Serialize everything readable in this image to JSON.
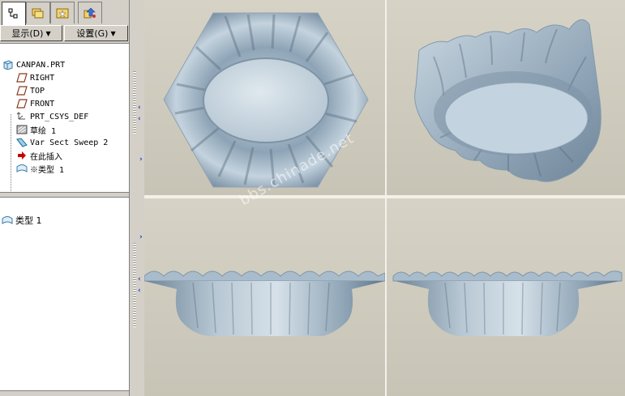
{
  "navigator": {
    "tabs": [
      {
        "icon": "model-tree-icon",
        "active": true
      },
      {
        "icon": "folder-browser-icon",
        "active": false
      },
      {
        "icon": "favorites-icon",
        "active": false
      },
      {
        "icon": "connections-icon",
        "active": false
      }
    ],
    "toolbar": {
      "show_label": "显示(D)",
      "settings_label": "设置(G)"
    },
    "tree": [
      {
        "label": "CANPAN.PRT",
        "icon": "part-icon"
      },
      {
        "label": "RIGHT",
        "icon": "datum-plane-icon"
      },
      {
        "label": "TOP",
        "icon": "datum-plane-icon"
      },
      {
        "label": "FRONT",
        "icon": "datum-plane-icon"
      },
      {
        "label": "PRT_CSYS_DEF",
        "icon": "csys-icon"
      },
      {
        "label": "草绘 1",
        "icon": "sketch-icon"
      },
      {
        "label": "Var Sect Sweep 2",
        "icon": "sweep-icon"
      },
      {
        "label": "在此插入",
        "icon": "insert-here-arrow-icon"
      },
      {
        "label": "※类型 1",
        "icon": "style-surface-icon"
      }
    ],
    "layers": [
      {
        "label": "类型 1",
        "icon": "style-surface-icon"
      }
    ]
  },
  "watermark": "bbs.chinade.net",
  "colors": {
    "background": "#d6d3c6",
    "model_surface": "#9fb3c4",
    "chevron": "#1a3cc9",
    "insert_arrow": "#cc0000"
  }
}
